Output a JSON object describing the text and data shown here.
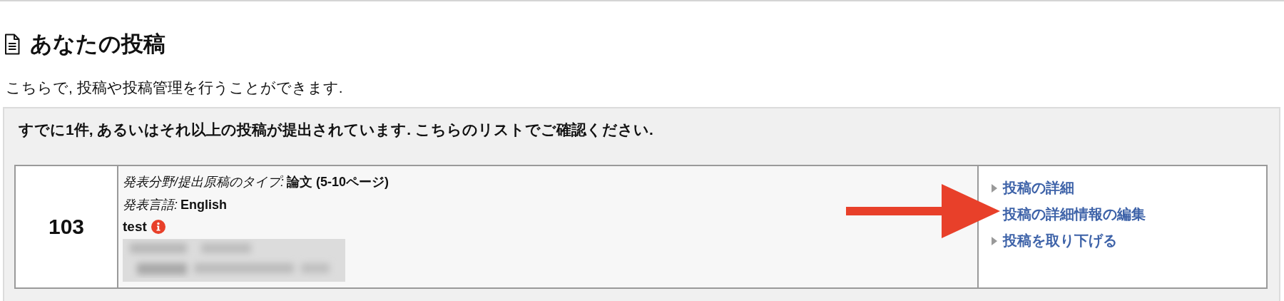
{
  "page": {
    "title": "あなたの投稿",
    "description": "こちらで, 投稿や投稿管理を行うことができます."
  },
  "notice": "すでに1件, あるいはそれ以上の投稿が提出されています. こちらのリストでご確認ください.",
  "submissions": [
    {
      "number": "103",
      "fields": [
        {
          "label": "発表分野/提出原稿のタイプ:",
          "value": "論文 (5-10ページ)"
        },
        {
          "label": "発表言語:",
          "value": "English"
        }
      ],
      "title": "test",
      "info_badge": true,
      "authors_blurred": true,
      "actions": [
        {
          "label": "投稿の詳細",
          "bullet": true
        },
        {
          "label": "投稿の詳細情報の編集",
          "bullet": false
        },
        {
          "label": "投稿を取り下げる",
          "bullet": true
        }
      ]
    }
  ]
}
